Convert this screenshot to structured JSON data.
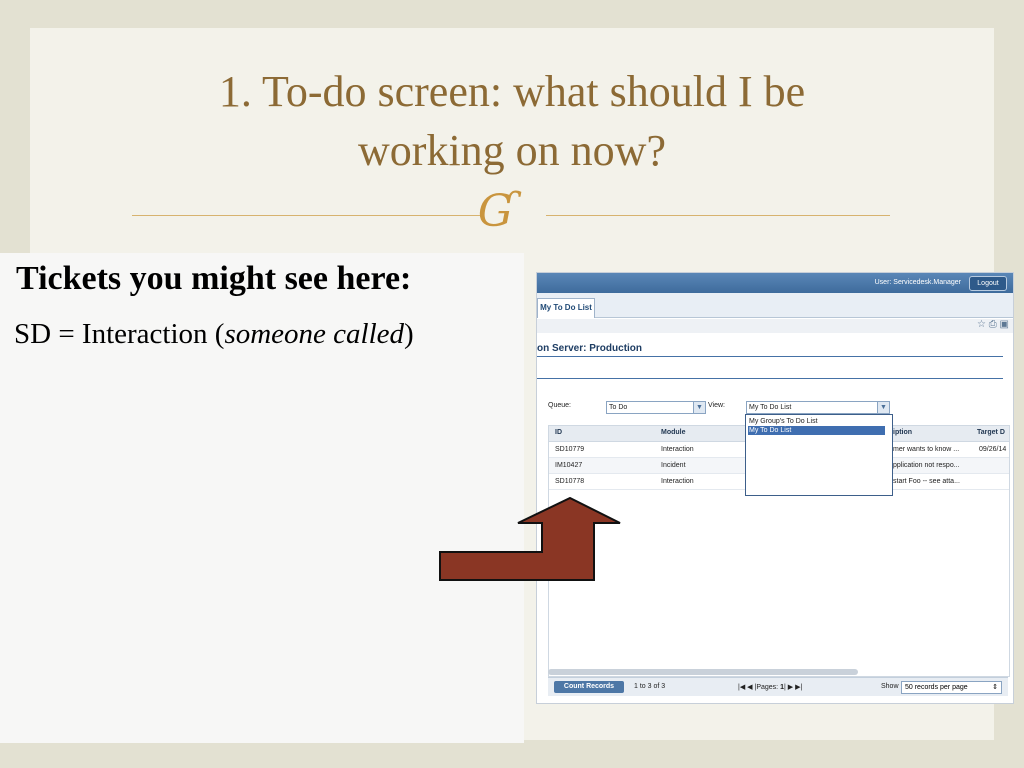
{
  "slide": {
    "title_line1": "1. To-do screen: what should I be",
    "title_line2": "working on now?",
    "flourish_glyph": "Ɠ",
    "heading": "Tickets you might see here:",
    "body_prefix": "SD = Interaction (",
    "body_italic": "someone called",
    "body_suffix": ")"
  },
  "app": {
    "user_label": "User: Servicedesk.Manager",
    "logout_label": "Logout",
    "tab_label": "My To Do List",
    "server_label": "on Server: Production",
    "queue_label": "Queue:",
    "queue_value": "To Do",
    "view_label": "View:",
    "view_value": "My To Do List",
    "view_options": [
      "My Group's To Do List",
      "My To Do List"
    ],
    "columns": [
      "ID",
      "Module",
      "iption",
      "Target D"
    ],
    "rows": [
      {
        "id": "SD10779",
        "module": "Interaction",
        "desc": "mer wants to know ...",
        "target": "09/26/14"
      },
      {
        "id": "IM10427",
        "module": "Incident",
        "desc": "pplication not respo...",
        "target": ""
      },
      {
        "id": "SD10778",
        "module": "Interaction",
        "desc": "start Foo -- see atta...",
        "target": ""
      }
    ],
    "count_button": "Count Records",
    "range_text": "1 to 3 of 3",
    "pages_label": "|Pages:",
    "page_number": "1",
    "show_label": "Show",
    "per_page": "50 records per page"
  },
  "colors": {
    "title": "#8c6a35",
    "arrow_fill": "#8a3624"
  }
}
